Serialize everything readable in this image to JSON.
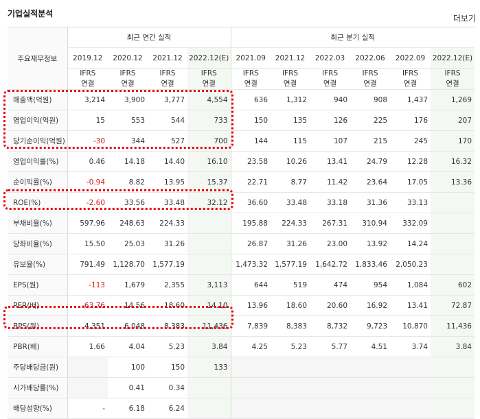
{
  "title": "기업실적분석",
  "more_label": "더보기",
  "header": {
    "row_label": "주요재무정보",
    "annual_group": "최근 연간 실적",
    "quarter_group": "최근 분기 실적",
    "annual_periods": [
      "2019.12",
      "2020.12",
      "2021.12",
      "2022.12(E)"
    ],
    "quarter_periods": [
      "2021.09",
      "2021.12",
      "2022.03",
      "2022.06",
      "2022.09",
      "2022.12(E)"
    ],
    "basis_top": "IFRS",
    "basis_bottom": "연결"
  },
  "rows": [
    {
      "label": "매출액(억원)",
      "values": [
        "3,214",
        "3,900",
        "3,777",
        "4,554",
        "636",
        "1,312",
        "940",
        "908",
        "1,437",
        "1,269"
      ]
    },
    {
      "label": "영업이익(억원)",
      "values": [
        "15",
        "553",
        "544",
        "733",
        "150",
        "135",
        "126",
        "225",
        "176",
        "207"
      ]
    },
    {
      "label": "당기순이익(억원)",
      "values": [
        "-30",
        "344",
        "527",
        "700",
        "144",
        "115",
        "107",
        "215",
        "245",
        "170"
      ]
    },
    {
      "label": "영업이익률(%)",
      "values": [
        "0.46",
        "14.18",
        "14.40",
        "16.10",
        "23.58",
        "10.26",
        "13.41",
        "24.79",
        "12.28",
        "16.32"
      ]
    },
    {
      "label": "순이익률(%)",
      "values": [
        "-0.94",
        "8.82",
        "13.95",
        "15.37",
        "22.71",
        "8.77",
        "11.42",
        "23.64",
        "17.05",
        "13.36"
      ]
    },
    {
      "label": "ROE(%)",
      "values": [
        "-2.60",
        "33.56",
        "33.48",
        "32.12",
        "36.60",
        "33.48",
        "33.18",
        "31.36",
        "33.13",
        ""
      ]
    },
    {
      "label": "부채비율(%)",
      "values": [
        "597.96",
        "248.63",
        "224.33",
        "",
        "195.88",
        "224.33",
        "267.31",
        "310.94",
        "332.09",
        ""
      ]
    },
    {
      "label": "당좌비율(%)",
      "values": [
        "15.50",
        "25.03",
        "31.26",
        "",
        "26.87",
        "31.26",
        "23.00",
        "13.92",
        "14.24",
        ""
      ]
    },
    {
      "label": "유보율(%)",
      "values": [
        "791.49",
        "1,128.70",
        "1,577.19",
        "",
        "1,473.32",
        "1,577.19",
        "1,642.72",
        "1,833.46",
        "2,050.23",
        ""
      ]
    },
    {
      "label": "EPS(원)",
      "values": [
        "-113",
        "1,679",
        "2,355",
        "3,113",
        "644",
        "519",
        "474",
        "954",
        "1,084",
        "602"
      ]
    },
    {
      "label": "PER(배)",
      "values": [
        "-63.76",
        "14.56",
        "18.60",
        "14.10",
        "13.96",
        "18.60",
        "20.60",
        "16.92",
        "13.41",
        "72.87"
      ]
    },
    {
      "label": "BPS(원)",
      "values": [
        "4,351",
        "6,048",
        "8,383",
        "11,436",
        "7,839",
        "8,383",
        "8,732",
        "9,723",
        "10,870",
        "11,436"
      ]
    },
    {
      "label": "PBR(배)",
      "values": [
        "1.66",
        "4.04",
        "5.23",
        "3.84",
        "4.25",
        "5.23",
        "5.77",
        "4.51",
        "3.74",
        "3.84"
      ]
    },
    {
      "label": "주당배당금(원)",
      "values": [
        "",
        "100",
        "150",
        "133",
        "",
        "",
        "",
        "",
        "",
        ""
      ]
    },
    {
      "label": "시가배당률(%)",
      "values": [
        "",
        "0.41",
        "0.34",
        "",
        "",
        "",
        "",
        "",
        "",
        ""
      ]
    },
    {
      "label": "배당성향(%)",
      "values": [
        "-",
        "6.18",
        "6.24",
        "",
        "",
        "",
        "",
        "",
        "",
        ""
      ]
    }
  ],
  "colors": {
    "negative": "#d21b1b",
    "basis": "#e36c09",
    "highlight": "#e8000b",
    "estimate_bg": "#f4f8f2"
  }
}
